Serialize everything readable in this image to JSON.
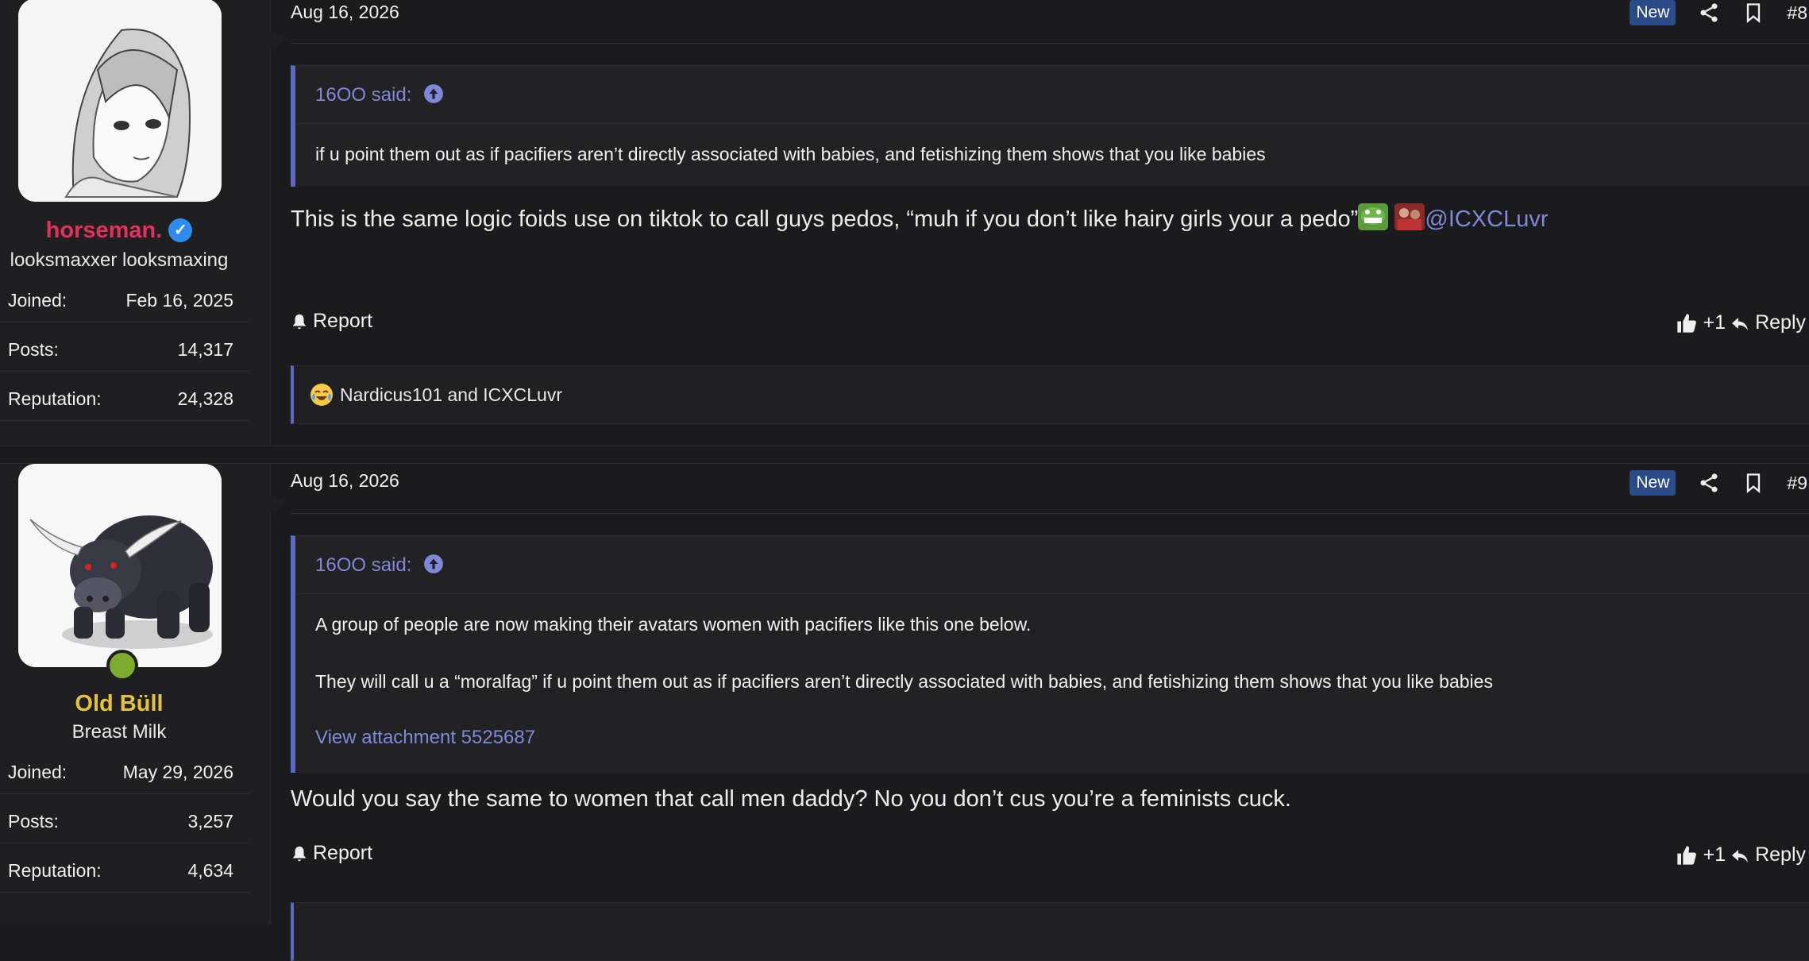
{
  "posts": [
    {
      "user": {
        "name": "horseman.",
        "title": "looksmaxxer looksmaxing",
        "verified": true,
        "online": false,
        "name_color": "#e0325b",
        "stats": [
          {
            "label": "Joined:",
            "value": "Feb 16, 2025"
          },
          {
            "label": "Posts:",
            "value": "14,317"
          },
          {
            "label": "Reputation:",
            "value": "24,328"
          }
        ]
      },
      "date": "Aug 16, 2026",
      "badge": "New",
      "number": "#8",
      "quote": {
        "author": "16OO said:",
        "lines": [
          "if u point them out as if pacifiers aren’t directly associated with babies, and fetishizing them shows that you like babies"
        ]
      },
      "content": "This is the same logic foids use on tiktok to call guys pedos, “muh if you don’t like hairy girls your a pedo”",
      "mention": "@ICXCLuvr",
      "report": "Report",
      "like": "+1",
      "reply": "Reply",
      "reactions": "Nardicus101 and ICXCLuvr"
    },
    {
      "user": {
        "name": "Old Büll",
        "title": "Breast Milk",
        "verified": false,
        "online": true,
        "name_color": "#e6c13a",
        "stats": [
          {
            "label": "Joined:",
            "value": "May 29, 2026"
          },
          {
            "label": "Posts:",
            "value": "3,257"
          },
          {
            "label": "Reputation:",
            "value": "4,634"
          }
        ]
      },
      "date": "Aug 16, 2026",
      "badge": "New",
      "number": "#9",
      "quote": {
        "author": "16OO said:",
        "lines": [
          "A group of people are now making their avatars women with pacifiers like this one below.",
          "They will call u a “moralfag” if u point them out as if pacifiers aren’t directly associated with babies, and fetishizing them shows that you like babies"
        ],
        "attachment": "View attachment 5525687"
      },
      "content": "Would you say the same to women that call men daddy? No you don’t cus you’re a feminists cuck.",
      "report": "Report",
      "like": "+1",
      "reply": "Reply"
    }
  ]
}
